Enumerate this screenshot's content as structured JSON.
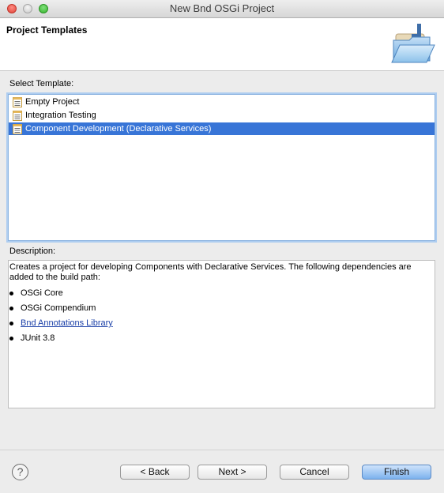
{
  "window": {
    "title": "New Bnd OSGi Project"
  },
  "header": {
    "title": "Project Templates",
    "icon": "folder-wizard-icon"
  },
  "templates": {
    "label": "Select Template:",
    "items": [
      {
        "label": "Empty Project",
        "icon": "template-icon",
        "selected": false
      },
      {
        "label": "Integration Testing",
        "icon": "template-icon",
        "selected": false
      },
      {
        "label": "Component Development (Declarative Services)",
        "icon": "template-icon",
        "selected": true
      }
    ]
  },
  "description": {
    "label": "Description:",
    "text": "Creates a project for developing Components with Declarative Services. The following dependencies are added to the build path:",
    "bullets": [
      {
        "text": "OSGi Core",
        "link": false
      },
      {
        "text": "OSGi Compendium",
        "link": false
      },
      {
        "text": "Bnd Annotations Library",
        "link": true
      },
      {
        "text": "JUnit 3.8",
        "link": false
      }
    ]
  },
  "footer": {
    "help_icon": "help-icon",
    "help_glyph": "?",
    "back_label": "< Back",
    "next_label": "Next >",
    "cancel_label": "Cancel",
    "finish_label": "Finish"
  },
  "colors": {
    "selection": "#3875d7",
    "link": "#1a3fa8",
    "primary_button": "#7cb2ee"
  }
}
